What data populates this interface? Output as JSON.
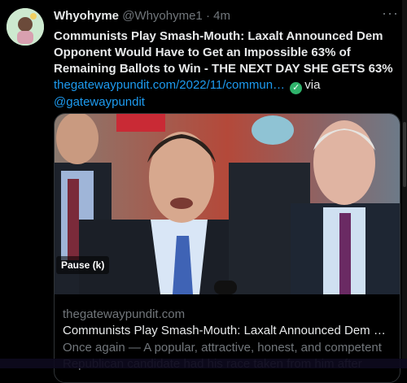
{
  "tweet": {
    "display_name": "Whyohyme",
    "handle": "@Whyohyme1",
    "separator": "·",
    "time": "4m",
    "more": "···",
    "headline": "Communists Play Smash-Mouth: Laxalt Announced Dem Opponent Would Have to Get an Impossible 63% of Remaining Ballots to Win - THE NEXT DAY SHE GETS 63%",
    "url": "thegatewaypundit.com/2022/11/commun…",
    "via_label": "via",
    "via_handle": "@gatewaypundit",
    "verified_icon": "check-badge-icon",
    "verified_color": "#2fb36b"
  },
  "card": {
    "pause_label": "Pause (k)",
    "domain": "thegatewaypundit.com",
    "title": "Communists Play Smash-Mouth: Laxalt Announced Dem O...",
    "description": "Once again — A popular, attractive, honest, and competent Republican candidate had his race taken from him after"
  },
  "colors": {
    "background": "#000000",
    "link": "#1d9bf0",
    "muted": "#71767b",
    "text": "#e7e9ea"
  }
}
